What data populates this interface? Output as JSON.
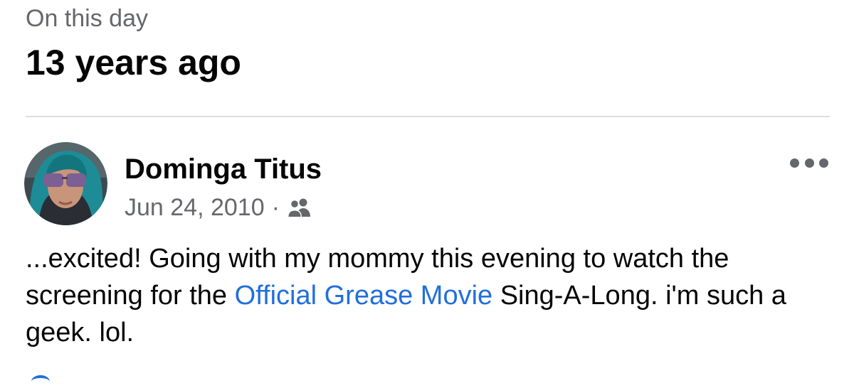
{
  "header": {
    "label": "On this day",
    "title": "13 years ago"
  },
  "post": {
    "author": "Dominga Titus",
    "date": "Jun 24, 2010",
    "separator": "·",
    "audience_icon": "friends-icon",
    "more_icon": "more-options-icon",
    "text_before_link": "...excited! Going with my mommy this evening to watch the screening for the ",
    "link_text": "Official Grease Movie",
    "text_after_link": " Sing-A-Long. i'm such a geek. lol."
  },
  "colors": {
    "secondary_text": "#65676b",
    "link": "#216fdb",
    "primary_text": "#050505",
    "divider": "#dcdde1"
  }
}
